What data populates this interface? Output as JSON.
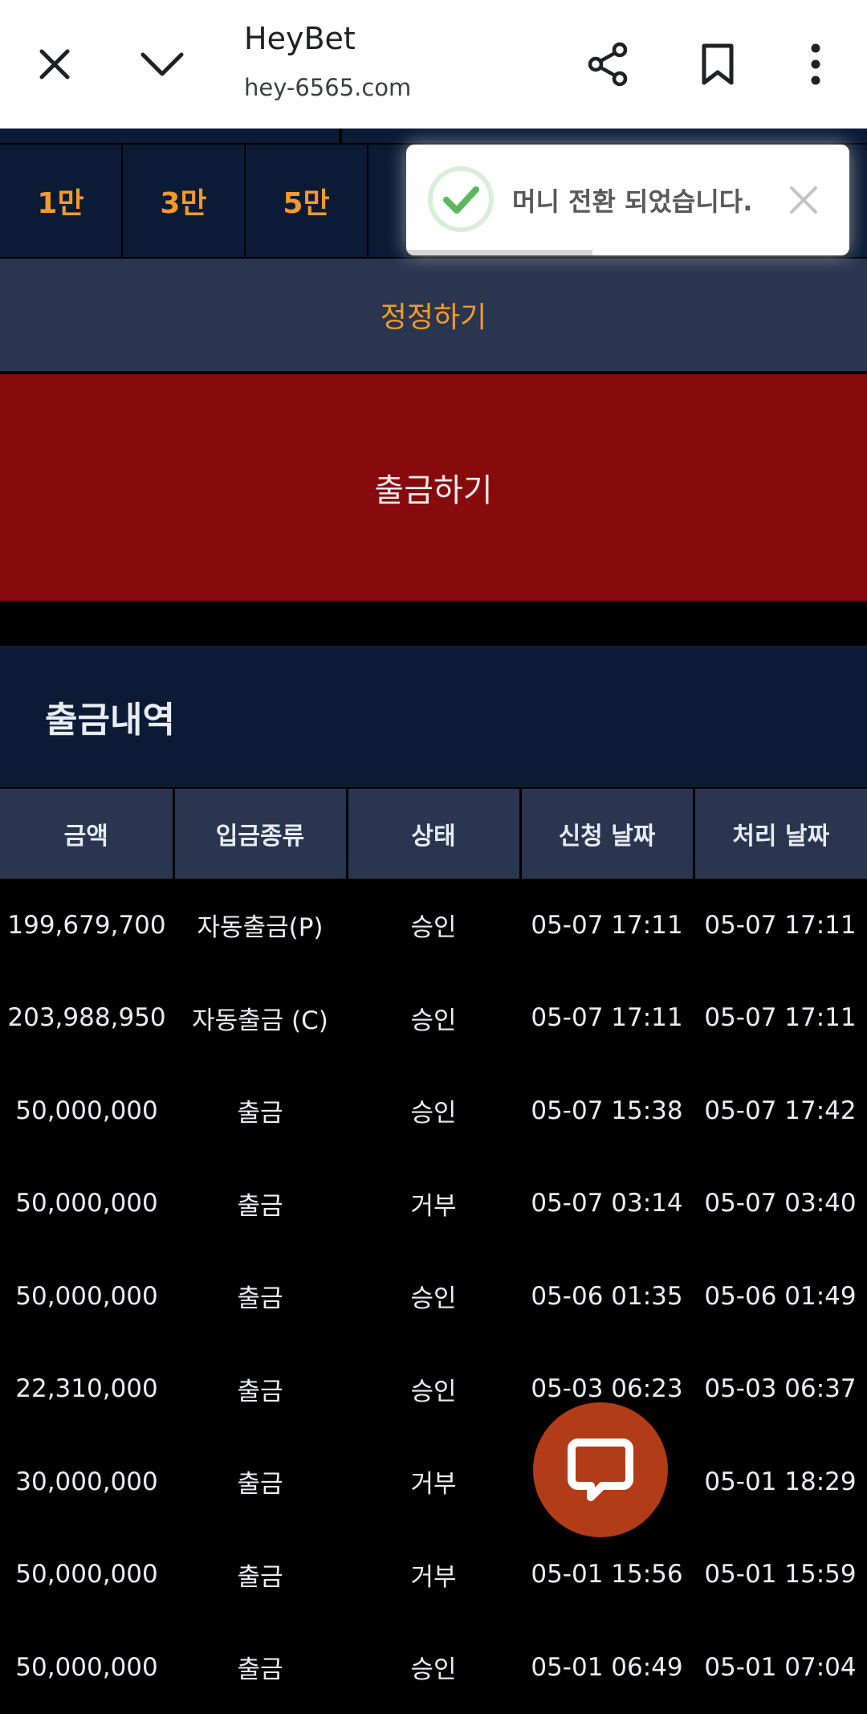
{
  "browser": {
    "site_title": "HeyBet",
    "site_url": "hey-6565.com",
    "icons": [
      "close-icon",
      "chevron-down-icon",
      "share-icon",
      "bookmark-icon",
      "more-vert-icon"
    ]
  },
  "amounts": [
    "1만",
    "3만",
    "5만"
  ],
  "correct_label": "정정하기",
  "withdraw_label": "출금하기",
  "history": {
    "title": "출금내역",
    "columns": [
      "금액",
      "입금종류",
      "상태",
      "신청 날짜",
      "처리 날짜"
    ],
    "rows": [
      [
        "199,679,700",
        "자동출금(P)",
        "승인",
        "05-07 17:11",
        "05-07 17:11"
      ],
      [
        "203,988,950",
        "자동출금 (C)",
        "승인",
        "05-07 17:11",
        "05-07 17:11"
      ],
      [
        "50,000,000",
        "출금",
        "승인",
        "05-07 15:38",
        "05-07 17:42"
      ],
      [
        "50,000,000",
        "출금",
        "거부",
        "05-07 03:14",
        "05-07 03:40"
      ],
      [
        "50,000,000",
        "출금",
        "승인",
        "05-06 01:35",
        "05-06 01:49"
      ],
      [
        "22,310,000",
        "출금",
        "승인",
        "05-03 06:23",
        "05-03 06:37"
      ],
      [
        "30,000,000",
        "출금",
        "거부",
        "",
        "05-01 18:29"
      ],
      [
        "50,000,000",
        "출금",
        "거부",
        "05-01 15:56",
        "05-01 15:59"
      ],
      [
        "50,000,000",
        "출금",
        "승인",
        "05-01 06:49",
        "05-01 07:04"
      ]
    ]
  },
  "toast": {
    "message": "머니 전환 되었습니다.",
    "progress_fraction": 0.42
  },
  "colors": {
    "accent_orange": "#f39a2a",
    "navy": "#0b1b35",
    "header_gray_blue": "#2a3550",
    "withdraw_red": "#870a0d",
    "chat_orange": "#b23c17",
    "success_green": "#5cb85c"
  }
}
